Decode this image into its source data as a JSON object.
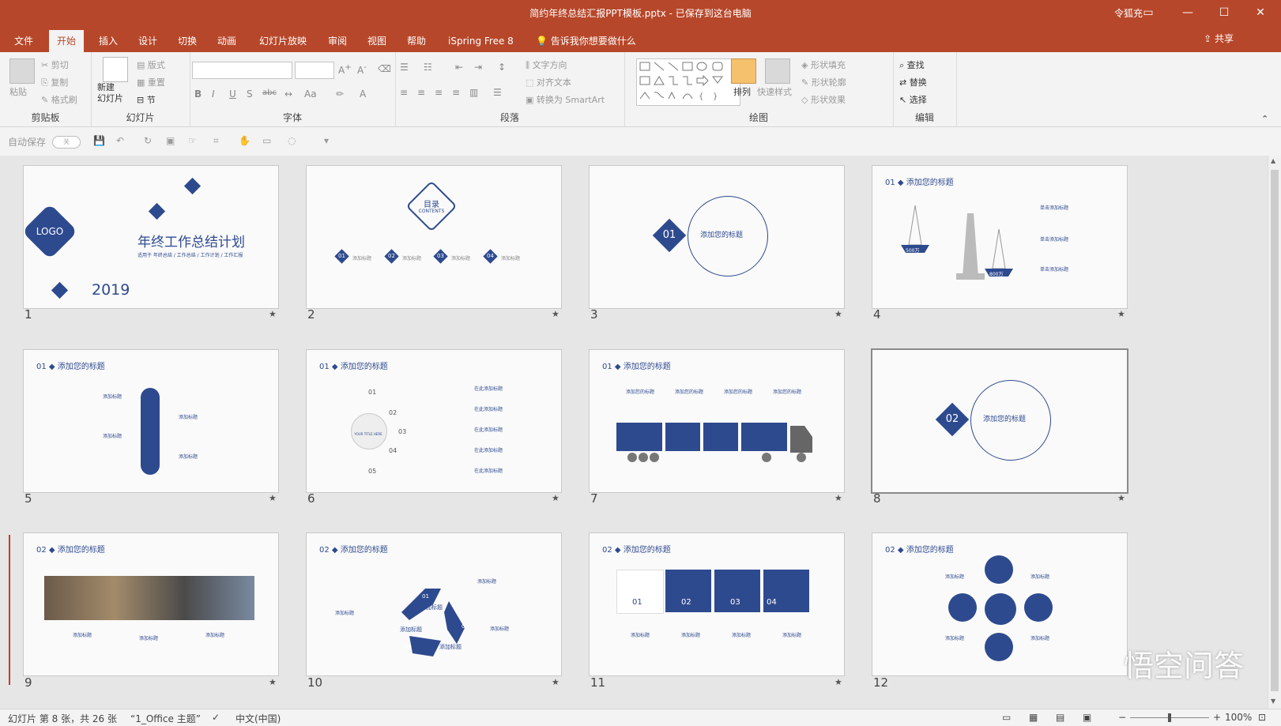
{
  "window": {
    "title": "简约年终总结汇报PPT模板.pptx - 已保存到这台电脑",
    "user": "令狐充",
    "share": "共享"
  },
  "tabs": [
    "文件",
    "开始",
    "插入",
    "设计",
    "切换",
    "动画",
    "幻灯片放映",
    "审阅",
    "视图",
    "帮助",
    "iSpring Free 8"
  ],
  "tell_me": "告诉我你想要做什么",
  "ribbon": {
    "clipboard": {
      "label": "剪贴板",
      "paste": "粘贴",
      "cut": "剪切",
      "copy": "复制",
      "format_painter": "格式刷"
    },
    "slides": {
      "label": "幻灯片",
      "new_slide": "新建\n幻灯片",
      "layout": "版式",
      "reset": "重置",
      "section": "节"
    },
    "font": {
      "label": "字体",
      "case": "Aa"
    },
    "paragraph": {
      "label": "段落",
      "text_direction": "文字方向",
      "align_text": "对齐文本",
      "smartart": "转换为 SmartArt"
    },
    "drawing": {
      "label": "绘图",
      "arrange": "排列",
      "quick_styles": "快速样式",
      "shape_fill": "形状填充",
      "shape_outline": "形状轮廓",
      "shape_effects": "形状效果"
    },
    "editing": {
      "label": "编辑",
      "find": "查找",
      "replace": "替换",
      "select": "选择"
    }
  },
  "qat": {
    "autosave": "自动保存",
    "toggle": "关"
  },
  "slides": [
    {
      "num": "1",
      "logo": "LOGO",
      "title": "年终工作总结计划",
      "subtitle": "适用于 年终总结 / 工作总结 / 工作计划 / 工作汇报",
      "year": "2019"
    },
    {
      "num": "2",
      "title": "目录",
      "sub": "CONTENTS",
      "items": [
        "01",
        "02",
        "03",
        "04"
      ],
      "item_label": "添加标题"
    },
    {
      "num": "3",
      "badge": "01",
      "title": "添加您的标题"
    },
    {
      "num": "4",
      "header_num": "01",
      "header": "添加您的标题",
      "v1": "500万",
      "v2": "800万",
      "item": "单击添加标题"
    },
    {
      "num": "5",
      "header_num": "01",
      "header": "添加您的标题",
      "item": "添加标题"
    },
    {
      "num": "6",
      "header_num": "01",
      "header": "添加您的标题",
      "center": "YOUR TITLE HERE",
      "steps": [
        "01",
        "02",
        "03",
        "04",
        "05"
      ],
      "item": "在此添加标题"
    },
    {
      "num": "7",
      "header_num": "01",
      "header": "添加您的标题",
      "item": "添加您的标题"
    },
    {
      "num": "8",
      "badge": "02",
      "title": "添加您的标题"
    },
    {
      "num": "9",
      "header_num": "02",
      "header": "添加您的标题",
      "item": "添加标题"
    },
    {
      "num": "10",
      "header_num": "02",
      "header": "添加您的标题",
      "steps": [
        "01",
        "02",
        "03"
      ],
      "label": "添加标题",
      "item": "添加标题"
    },
    {
      "num": "11",
      "header_num": "02",
      "header": "添加您的标题",
      "pieces": [
        "01",
        "02",
        "03",
        "04"
      ],
      "item": "添加标题"
    },
    {
      "num": "12",
      "header_num": "02",
      "header": "添加您的标题",
      "item": "添加标题"
    }
  ],
  "status": {
    "slide_info": "幻灯片 第 8 张，共 26 张",
    "theme": "“1_Office 主题”",
    "lang": "中文(中国)",
    "zoom": "100%",
    "zoom_fraction": 0.5
  },
  "watermark": "悟空问答",
  "colors": {
    "accent": "#b7472a",
    "navy": "#2e4a8f"
  }
}
